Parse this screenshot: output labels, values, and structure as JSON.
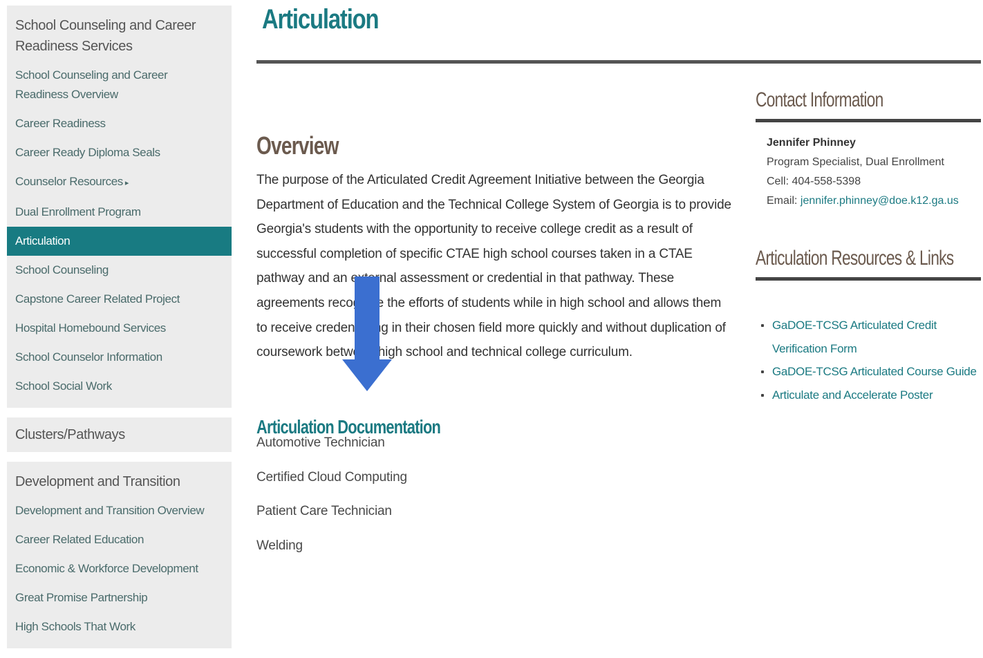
{
  "sidebar": {
    "section1": {
      "heading": "School Counseling and Career Readiness Services",
      "items": [
        "School Counseling and Career Readiness Overview",
        "Career Readiness",
        "Career Ready Diploma Seals",
        "Counselor Resources",
        "Dual Enrollment Program",
        "Articulation",
        "School Counseling",
        "Capstone Career Related Project",
        "Hospital Homebound Services",
        "School Counselor Information",
        "School Social Work"
      ],
      "active_item": "Articulation"
    },
    "section2": {
      "heading": "Clusters/Pathways"
    },
    "section3": {
      "heading": "Development and Transition",
      "items": [
        "Development and Transition Overview",
        "Career Related Education",
        "Economic & Workforce Development",
        "Great Promise Partnership",
        "High Schools That Work"
      ]
    },
    "submenu_icon": "caret-right-icon"
  },
  "main": {
    "title": "Articulation",
    "overview_heading": "Overview",
    "overview_text": "The purpose of the Articulated Credit Agreement Initiative between the Georgia Department of Education and the Technical College System of Georgia is to provide Georgia's students with the opportunity to receive college credit as a result of successful completion of specific CTAE high school courses taken in a CTAE pathway and an external assessment or credential in that pathway. These agreements recognize the efforts of students while in high school and allows them to receive credentialing in their chosen field more quickly and without duplication of coursework between high school and technical college curriculum.",
    "documentation_heading": "Articulation Documentation",
    "documentation_links": [
      "Automotive Technician",
      "Certified Cloud Computing",
      "Patient Care Technician",
      "Welding"
    ]
  },
  "right": {
    "contact_heading": "Contact Information",
    "contact": {
      "name": "Jennifer Phinney",
      "title": "Program Specialist, Dual Enrollment",
      "cell_label": "Cell: ",
      "cell": "404-558-5398",
      "email_label": "Email: ",
      "email": "jennifer.phinney@doe.k12.ga.us"
    },
    "resources_heading": "Articulation Resources & Links",
    "resources": [
      "GaDOE-TCSG Articulated Credit Verification Form",
      "GaDOE-TCSG Articulated Course Guide",
      "Articulate and Accelerate Poster"
    ]
  },
  "overlay": {
    "icon": "down-arrow-icon",
    "color": "#3b6fd0"
  },
  "colors": {
    "accent": "#1b7a82",
    "heading_brown": "#6b5a4e",
    "sidebar_bg": "#ececec"
  }
}
